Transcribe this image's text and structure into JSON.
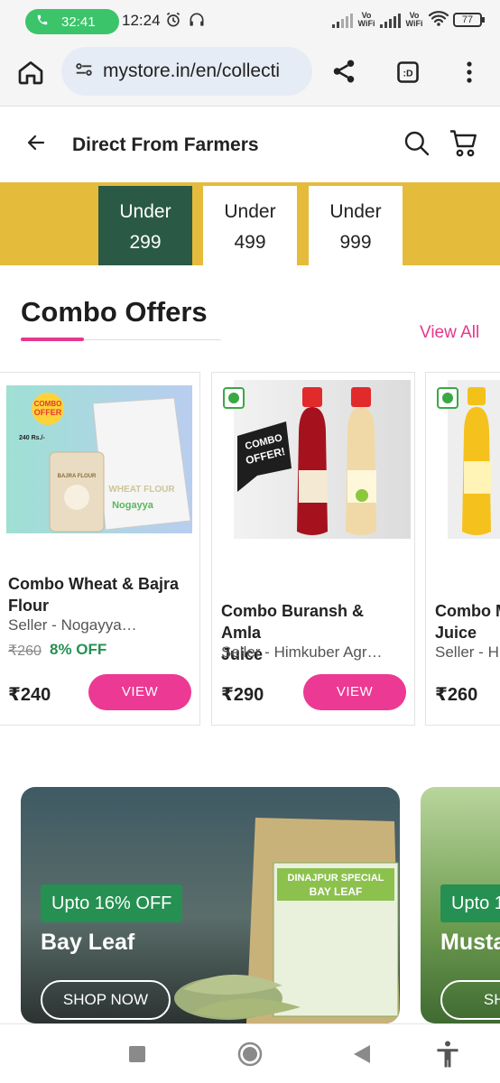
{
  "status_bar": {
    "call_timer": "32:41",
    "time": "12:24",
    "network_labels": [
      "Vo WiFi",
      "Vo WiFi"
    ],
    "battery": "77"
  },
  "browser": {
    "url": "mystore.in/en/collecti"
  },
  "header": {
    "title": "Direct From Farmers"
  },
  "price_filters": [
    {
      "label1": "Under",
      "label2": "299"
    },
    {
      "label1": "Under",
      "label2": "499"
    },
    {
      "label1": "Under",
      "label2": "999"
    }
  ],
  "combo": {
    "title": "Combo Offers",
    "view_all": "View All",
    "products": [
      {
        "name_line1": "Combo Wheat & Bajra",
        "name_line2": "Flour",
        "seller": "Seller - Nogayya…",
        "mrp": "₹260",
        "discount": "8% OFF",
        "price": "₹240",
        "button": "VIEW",
        "img_badge_1": "COMBO",
        "img_badge_2": "OFFER",
        "img_caption": "240 Rs./-",
        "img_bag_1": "WHEAT FLOUR",
        "img_bag_2": "Nogayya",
        "img_bag_3": "BAJRA FLOUR"
      },
      {
        "name_line1": "Combo Buransh & Amla",
        "name_line2": "Juice",
        "seller": "Seller - Himkuber Agr…",
        "price": "₹290",
        "button": "VIEW",
        "img_tag_1": "COMBO",
        "img_tag_2": "OFFER!"
      },
      {
        "name_line1": "Combo M",
        "name_line2": "Juice",
        "seller": "Seller - H",
        "price": "₹260"
      }
    ]
  },
  "banners": [
    {
      "badge": "Upto 16% OFF",
      "title": "Bay Leaf",
      "button": "SHOP NOW",
      "pack_title_1": "DINAJPUR SPECIAL",
      "pack_title_2": "BAY LEAF"
    },
    {
      "badge": "Upto 1",
      "title": "Musta",
      "button": "SHOP"
    }
  ],
  "colors": {
    "accent_pink": "#ec3993",
    "band_yellow": "#e5bb3c",
    "active_green": "#2a5a45",
    "offer_green": "#259052"
  }
}
